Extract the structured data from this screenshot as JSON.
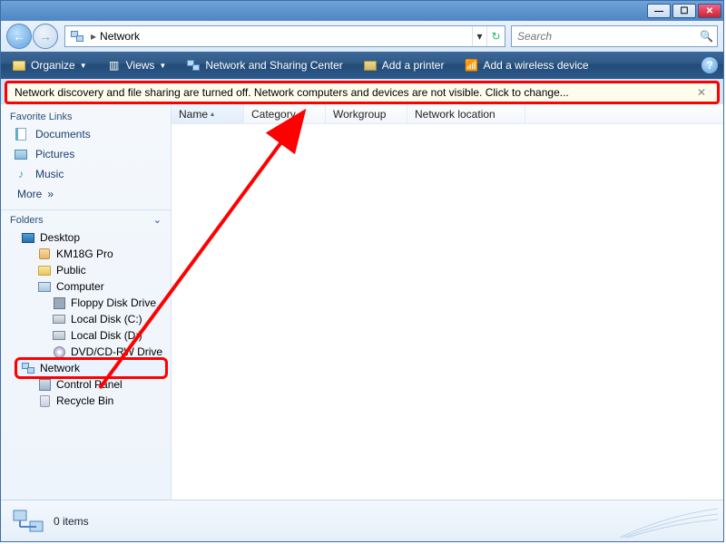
{
  "titlebar": {
    "minimize": "—",
    "maximize": "☐",
    "close": "✕"
  },
  "nav": {
    "back_symbol": "←",
    "forward_symbol": "→",
    "breadcrumb_sep": "▸",
    "location": "Network",
    "dropdown_symbol": "▾",
    "refresh_symbol": "↻"
  },
  "search": {
    "placeholder": "Search",
    "icon": "🔍"
  },
  "cmdbar": {
    "organize": "Organize",
    "views": "Views",
    "nsc": "Network and Sharing Center",
    "add_printer": "Add a printer",
    "add_wireless": "Add a wireless device",
    "help_symbol": "?"
  },
  "infobar": {
    "message": "Network discovery and file sharing are turned off. Network computers and devices are not visible. Click to change...",
    "close_symbol": "✕"
  },
  "sidebar": {
    "fav_header": "Favorite Links",
    "documents": "Documents",
    "pictures": "Pictures",
    "music": "Music",
    "more": "More",
    "more_arrow": "»",
    "folders_header": "Folders",
    "folders_chevron": "⌄",
    "tree": {
      "desktop": "Desktop",
      "user": "KM18G Pro",
      "public": "Public",
      "computer": "Computer",
      "floppy": "Floppy Disk Drive",
      "localc": "Local Disk (C:)",
      "locald": "Local Disk (D:)",
      "dvd": "DVD/CD-RW Drive",
      "network": "Network",
      "control_panel": "Control Panel",
      "recycle_bin": "Recycle Bin"
    }
  },
  "columns": {
    "name": "Name",
    "category": "Category",
    "workgroup": "Workgroup",
    "network_location": "Network location",
    "sort_symbol": "▴"
  },
  "status": {
    "text": "0 items"
  }
}
